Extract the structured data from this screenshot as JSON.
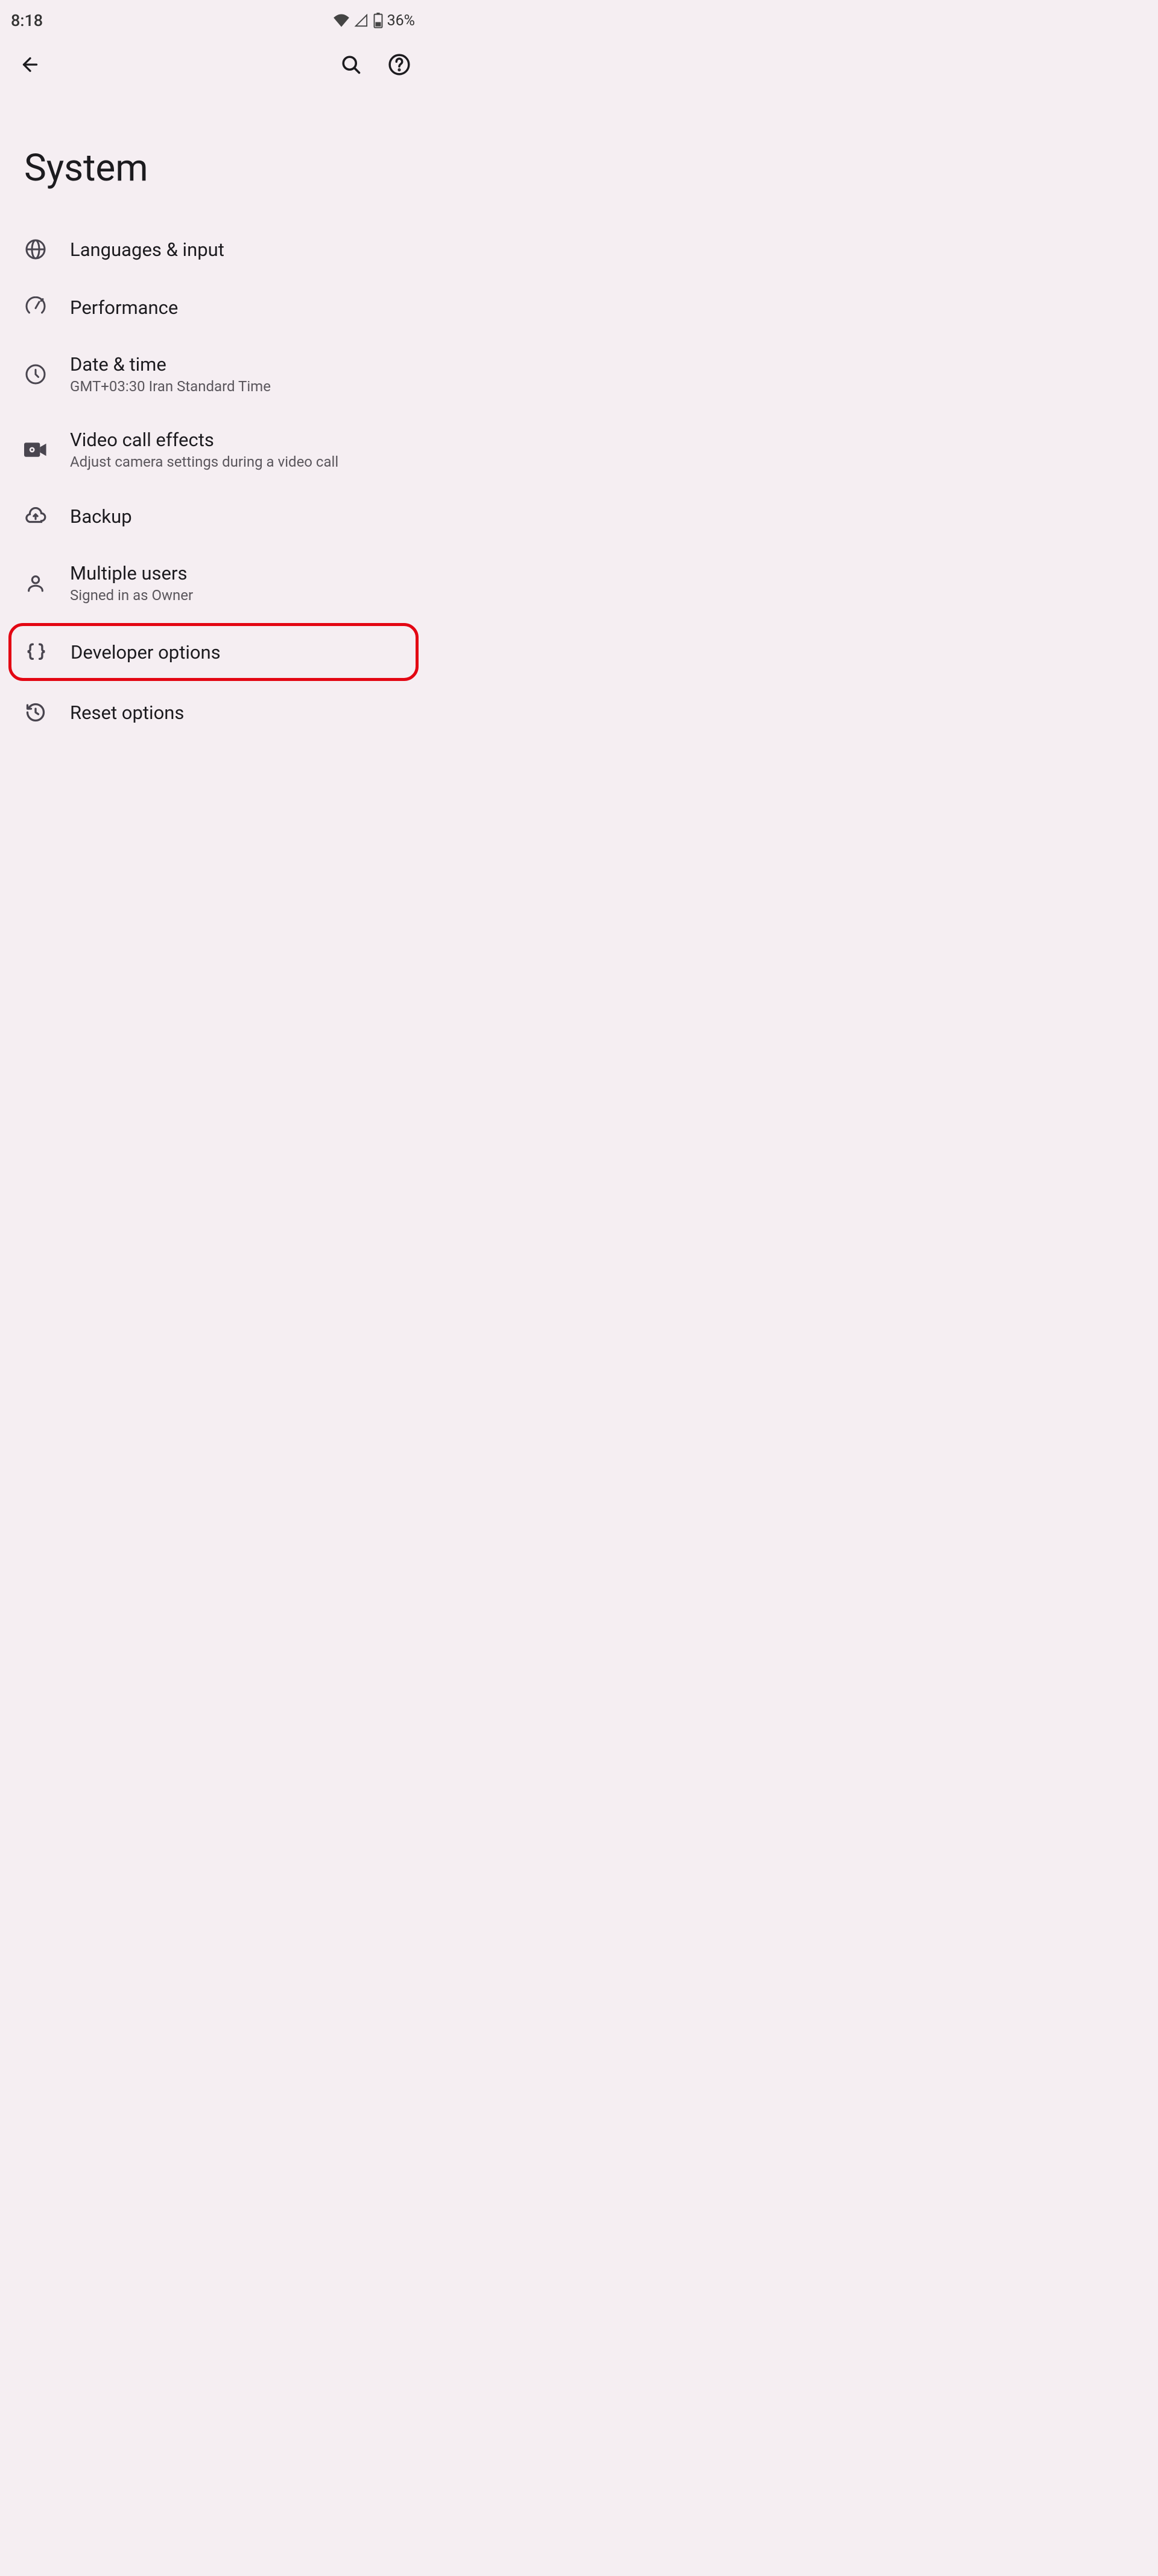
{
  "status_bar": {
    "time": "8:18",
    "battery": "36%"
  },
  "page": {
    "title": "System"
  },
  "items": [
    {
      "id": "languages",
      "title": "Languages & input",
      "subtitle": ""
    },
    {
      "id": "performance",
      "title": "Performance",
      "subtitle": ""
    },
    {
      "id": "datetime",
      "title": "Date & time",
      "subtitle": "GMT+03:30 Iran Standard Time"
    },
    {
      "id": "videocall",
      "title": "Video call effects",
      "subtitle": "Adjust camera settings during a video call"
    },
    {
      "id": "backup",
      "title": "Backup",
      "subtitle": ""
    },
    {
      "id": "multipleusers",
      "title": "Multiple users",
      "subtitle": "Signed in as Owner"
    },
    {
      "id": "developer",
      "title": "Developer options",
      "subtitle": ""
    },
    {
      "id": "reset",
      "title": "Reset options",
      "subtitle": ""
    }
  ]
}
